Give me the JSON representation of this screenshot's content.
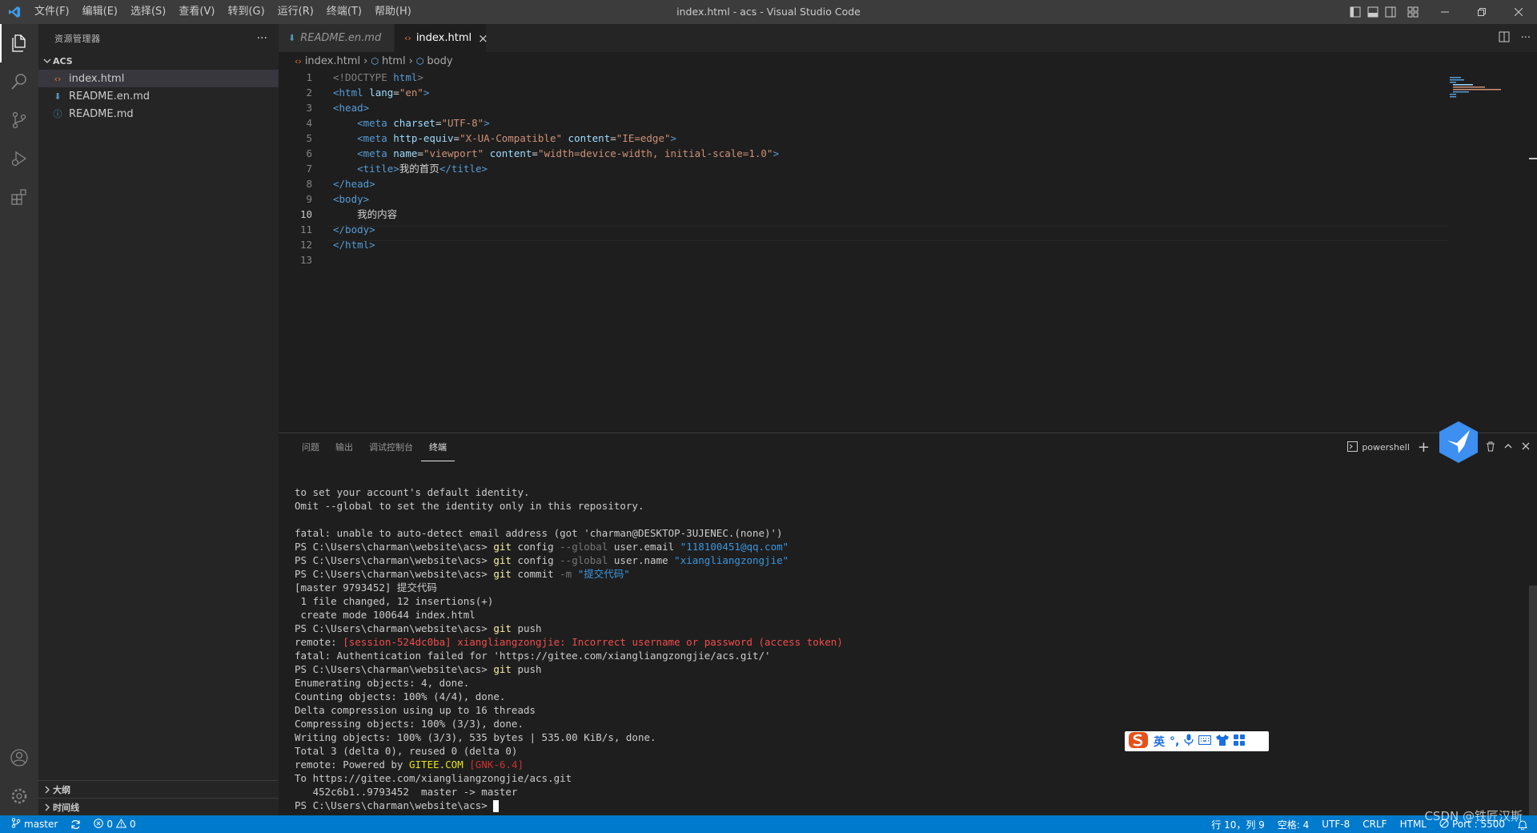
{
  "app": {
    "window_title": "index.html - acs - Visual Studio Code"
  },
  "menubar": {
    "items": [
      "文件(F)",
      "编辑(E)",
      "选择(S)",
      "查看(V)",
      "转到(G)",
      "运行(R)",
      "终端(T)",
      "帮助(H)"
    ]
  },
  "sidebar": {
    "title": "资源管理器",
    "more": "···",
    "folder": "ACS",
    "files": [
      {
        "name": "index.html",
        "icon": "html-file-icon",
        "color": "#e37933"
      },
      {
        "name": "README.en.md",
        "icon": "markdown-file-icon",
        "color": "#519aba"
      },
      {
        "name": "README.md",
        "icon": "info-file-icon",
        "color": "#519aba"
      }
    ],
    "outline": "大纲",
    "timeline": "时间线"
  },
  "editor": {
    "tabs": [
      {
        "label": "README.en.md",
        "active": false
      },
      {
        "label": "index.html",
        "active": true
      }
    ],
    "close_glyph": "×",
    "breadcrumb": [
      "index.html",
      "html",
      "body"
    ],
    "line_numbers": [
      "1",
      "2",
      "3",
      "4",
      "5",
      "6",
      "7",
      "8",
      "9",
      "10",
      "11",
      "12",
      "13"
    ],
    "current_line": 10
  },
  "code": {
    "l1_doctype": "<!DOCTYPE",
    "l1_html": "html",
    "l2_open": "<html",
    "l2_attr": "lang",
    "l2_val": "\"en\"",
    "head_open": "<head>",
    "meta": "<meta",
    "l4_attr": "charset",
    "l4_val": "\"UTF-8\"",
    "l5_attr": "http-equiv",
    "l5_val": "\"X-UA-Compatible\"",
    "l5_attr2": "content",
    "l5_val2": "\"IE=edge\"",
    "l6_attr": "name",
    "l6_val": "\"viewport\"",
    "l6_attr2": "content",
    "l6_val2": "\"width=device-width, initial-scale=1.0\"",
    "title_open": "<title>",
    "title_text": "我的首页",
    "title_close": "</title>",
    "head_close": "</head>",
    "body_open": "<body>",
    "body_text": "我的内容",
    "body_close": "</body>",
    "html_close": "</html>",
    "gt": ">",
    "eq": "="
  },
  "panel": {
    "tabs": [
      "问题",
      "输出",
      "调试控制台",
      "终端"
    ],
    "active_tab": "终端",
    "shell": "powershell"
  },
  "terminal": {
    "prompt": "PS C:\\Users\\charman\\website\\acs>",
    "lines": {
      "l1": "to set your account's default identity.",
      "l2": "Omit --global to set the identity only in this repository.",
      "l3": "fatal: unable to auto-detect email address (got 'charman@DESKTOP-3UJENEC.(none)')",
      "git": "git",
      "config": "config",
      "global_flag": "--global",
      "user_email": "user.email",
      "email_val": "\"118100451@qq.com\"",
      "user_name": "user.name",
      "name_val": "\"xiangliangzongjie\"",
      "commit": "commit",
      "m_flag": "-m",
      "commit_msg": "\"提交代码\"",
      "l7": "[master 9793452] 提交代码",
      "l8": " 1 file changed, 12 insertions(+)",
      "l9": " create mode 100644 index.html",
      "push": "push",
      "remote_prefix": "remote: ",
      "remote_err": "[session-524dc0ba] xiangliangzongjie: Incorrect username or password (access token)",
      "l12": "fatal: Authentication failed for 'https://gitee.com/xiangliangzongjie/acs.git/'",
      "l14": "Enumerating objects: 4, done.",
      "l15": "Counting objects: 100% (4/4), done.",
      "l16": "Delta compression using up to 16 threads",
      "l17": "Compressing objects: 100% (3/3), done.",
      "l18": "Writing objects: 100% (3/3), 535 bytes | 535.00 KiB/s, done.",
      "l19": "Total 3 (delta 0), reused 0 (delta 0)",
      "l20_prefix": "remote: Powered by ",
      "gitee": "GITEE.COM",
      "gnk": "[GNK-6.4]",
      "l21": "To https://gitee.com/xiangliangzongjie/acs.git",
      "l22": "   452c6b1..9793452  master -> master"
    }
  },
  "ime": {
    "lang": "英",
    "punct": "°,"
  },
  "statusbar": {
    "branch": "master",
    "errors": "0",
    "warnings": "0",
    "position": "行 10，列 9",
    "spaces": "空格: 4",
    "encoding": "UTF-8",
    "eol": "CRLF",
    "language": "HTML",
    "port": "Port : 5500"
  },
  "watermark": "CSDN @铁匠汉斯",
  "colors": {
    "accent": "#007acc",
    "title_bar": "#3c3c3c",
    "activity_bar": "#333333",
    "sidebar": "#252526",
    "editor": "#1e1e1e"
  }
}
